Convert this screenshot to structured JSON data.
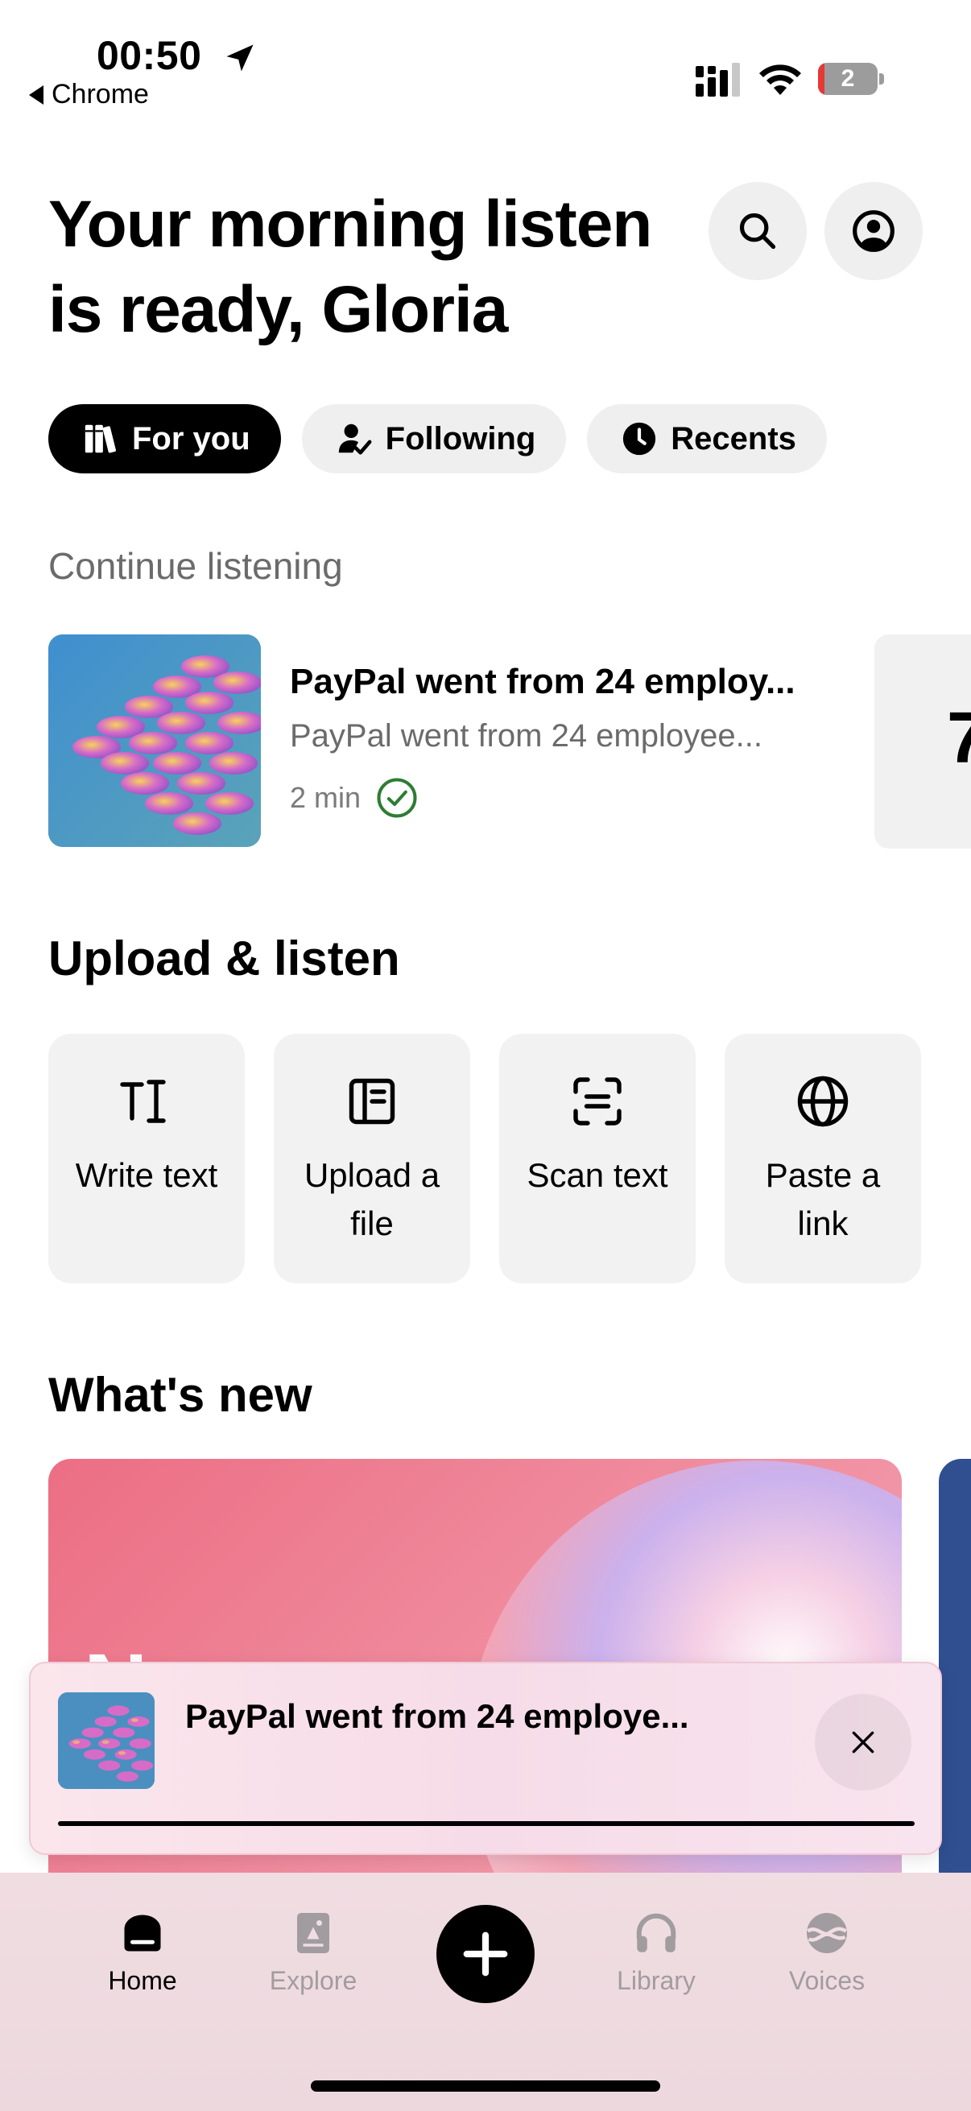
{
  "status_bar": {
    "time": "00:50",
    "back_app": "Chrome",
    "battery": "2",
    "icons": [
      "location-arrow-icon",
      "cellular-signal-icon",
      "wifi-icon",
      "battery-icon"
    ]
  },
  "header": {
    "greeting": "Your morning listen is ready, Gloria",
    "icons": [
      "search-icon",
      "profile-icon"
    ]
  },
  "filters": [
    {
      "label": "For you",
      "icon": "books-icon",
      "active": true
    },
    {
      "label": "Following",
      "icon": "person-check-icon",
      "active": false
    },
    {
      "label": "Recents",
      "icon": "clock-icon",
      "active": false
    }
  ],
  "continue_listening": {
    "heading": "Continue listening",
    "item": {
      "title": "PayPal went from 24 employ...",
      "subtitle": "PayPal went from 24 employee...",
      "duration": "2 min",
      "completed": true
    },
    "next_card_glyph": "7"
  },
  "upload": {
    "heading": "Upload & listen",
    "tiles": [
      {
        "label": "Write text",
        "icon": "text-cursor-icon"
      },
      {
        "label": "Upload a file",
        "icon": "document-icon"
      },
      {
        "label": "Scan text",
        "icon": "scan-icon"
      },
      {
        "label": "Paste a link",
        "icon": "globe-icon"
      }
    ]
  },
  "whats_new": {
    "heading": "What's new",
    "promo_letter": "N"
  },
  "mini_player": {
    "title": "PayPal went from 24 employe...",
    "progress": 1.0
  },
  "tab_bar": {
    "tabs": [
      {
        "label": "Home",
        "icon": "home-icon",
        "active": true
      },
      {
        "label": "Explore",
        "icon": "explore-icon",
        "active": false
      },
      {
        "label": "Library",
        "icon": "headphones-icon",
        "active": false
      },
      {
        "label": "Voices",
        "icon": "voices-icon",
        "active": false
      }
    ],
    "center_action": "add-icon"
  },
  "colors": {
    "accent": "#000000",
    "check_green": "#2e7d32",
    "inactive_tab": "#a19ca0",
    "promo_pink": "#ec6e84"
  }
}
